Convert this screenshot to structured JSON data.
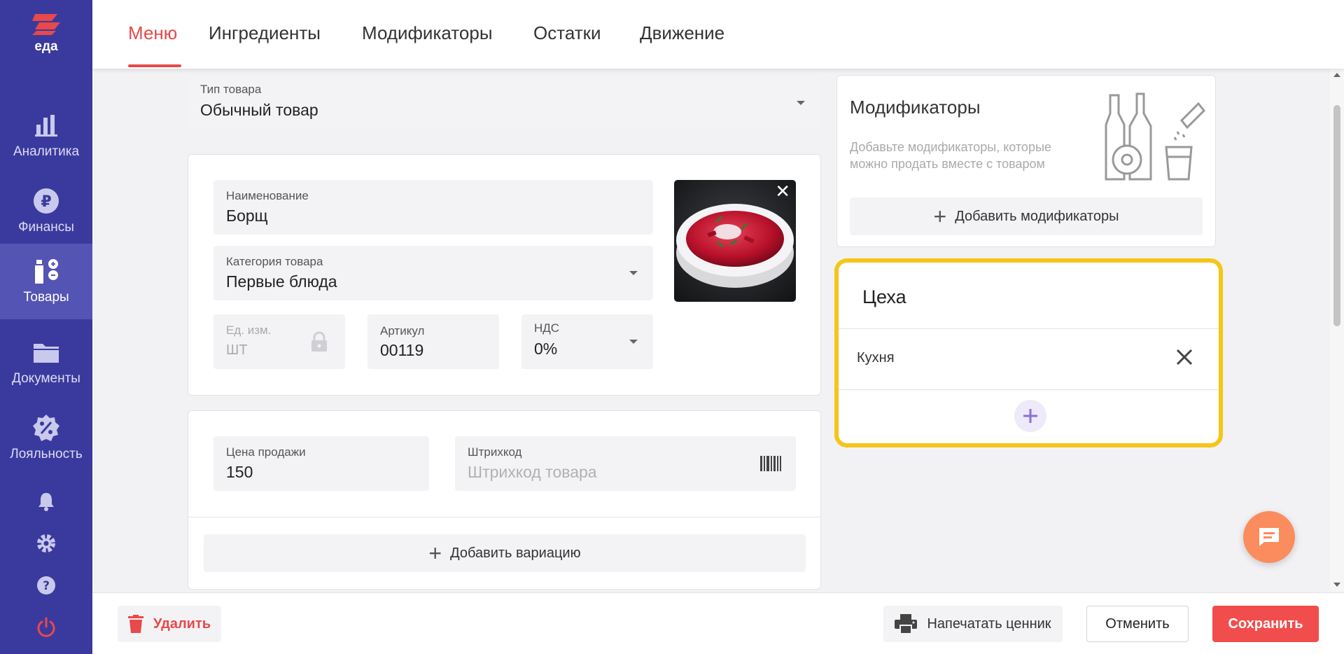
{
  "brand": {
    "name": "еда",
    "accent": "#e8494a"
  },
  "sidebar": {
    "items": [
      {
        "label": "Аналитика",
        "icon": "bar-chart-icon"
      },
      {
        "label": "Финансы",
        "icon": "ruble-icon"
      },
      {
        "label": "Товары",
        "icon": "products-icon",
        "active": true
      },
      {
        "label": "Документы",
        "icon": "folder-icon"
      },
      {
        "label": "Лояльность",
        "icon": "discount-icon"
      }
    ],
    "bottom_icons": [
      "bell-icon",
      "gear-icon",
      "help-icon",
      "power-icon"
    ]
  },
  "tabs": [
    {
      "label": "Меню",
      "active": true
    },
    {
      "label": "Ингредиенты"
    },
    {
      "label": "Модификаторы"
    },
    {
      "label": "Остатки"
    },
    {
      "label": "Движение"
    }
  ],
  "product": {
    "type": {
      "label": "Тип товара",
      "value": "Обычный товар"
    },
    "name": {
      "label": "Наименование",
      "value": "Борщ"
    },
    "category": {
      "label": "Категория товара",
      "value": "Первые блюда"
    },
    "unit": {
      "label": "Ед. изм.",
      "value": "ШТ"
    },
    "sku": {
      "label": "Артикул",
      "value": "00119"
    },
    "vat": {
      "label": "НДС",
      "value": "0%"
    },
    "price": {
      "label": "Цена продажи",
      "value": "150"
    },
    "barcode": {
      "label": "Штрихкод",
      "placeholder": "Штрихкод товара"
    },
    "add_variation": "Добавить вариацию"
  },
  "modifiers": {
    "title": "Модификаторы",
    "description": "Добавьте модификаторы, которые можно продать вместе с товаром",
    "add_button": "Добавить модификаторы"
  },
  "workshops": {
    "title": "Цеха",
    "items": [
      "Кухня"
    ],
    "highlight_color": "#f5c518"
  },
  "footer": {
    "delete": "Удалить",
    "print": "Напечатать ценник",
    "cancel": "Отменить",
    "save": "Сохранить"
  }
}
